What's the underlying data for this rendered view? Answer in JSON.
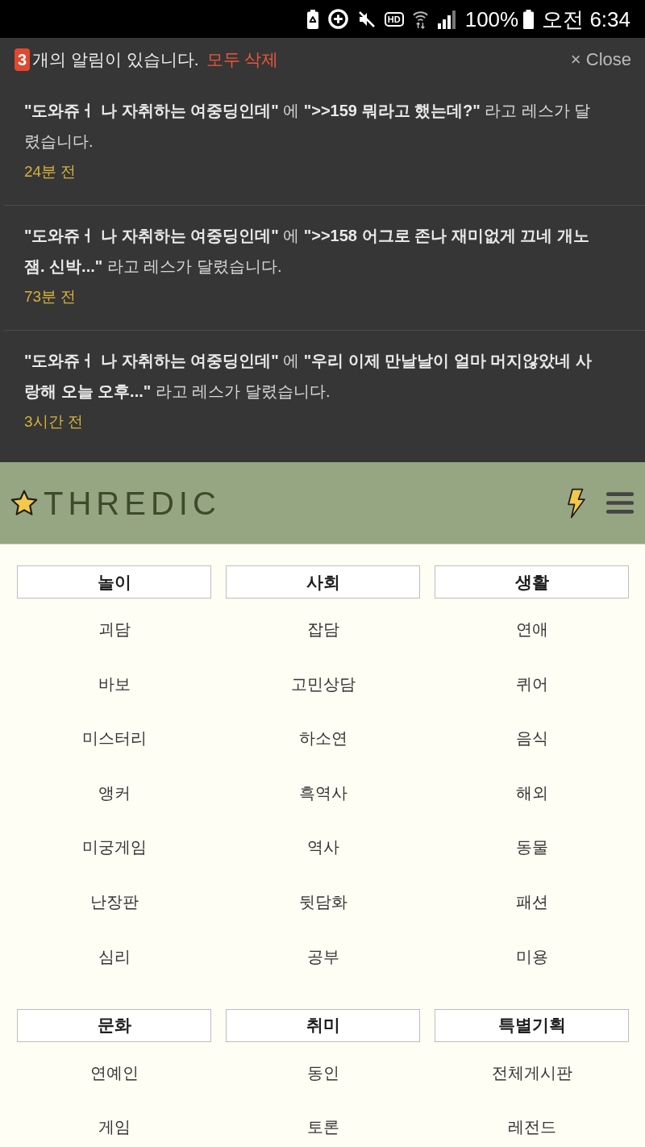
{
  "status_bar": {
    "hd_label": "HD",
    "battery_text": "100%",
    "time": "오전 6:34"
  },
  "notifications": {
    "count": "3",
    "summary": "개의 알림이 있습니다.",
    "clear_all": "모두 삭제",
    "close": "× Close",
    "items": [
      {
        "text": "**\"도와쥬ㅓ 나 자취하는 여중딩인데\"** 에 **\">>159 뭐라고 했는데?\"** 라고 레스가 달렸습니다.",
        "time": "24분 전"
      },
      {
        "text": "**\"도와쥬ㅓ 나 자취하는 여중딩인데\"** 에 **\">>158 어그로 존나 재미없게 끄네 개노잼. 신박...\"** 라고 레스가 달렸습니다.",
        "time": "73분 전"
      },
      {
        "text": "**\"도와쥬ㅓ 나 자취하는 여중딩인데\"** 에 **\"우리 이제 만날날이 얼마 머지않았네 사랑해 오늘 오후...\"** 라고 레스가 달렸습니다.",
        "time": "3시간 전"
      }
    ]
  },
  "navbar": {
    "logo_text": "THREDIC"
  },
  "menu": {
    "sections": [
      {
        "columns": [
          {
            "title": "놀이",
            "items": [
              "괴담",
              "바보",
              "미스터리",
              "앵커",
              "미궁게임",
              "난장판",
              "심리"
            ]
          },
          {
            "title": "사회",
            "items": [
              "잡담",
              "고민상담",
              "하소연",
              "흑역사",
              "역사",
              "뒷담화",
              "공부"
            ]
          },
          {
            "title": "생활",
            "items": [
              "연애",
              "퀴어",
              "음식",
              "해외",
              "동물",
              "패션",
              "미용"
            ]
          }
        ]
      },
      {
        "columns": [
          {
            "title": "문화",
            "items": [
              "연예인",
              "게임"
            ]
          },
          {
            "title": "취미",
            "items": [
              "동인",
              "토론"
            ]
          },
          {
            "title": "특별기획",
            "items": [
              "전체게시판",
              "레전드"
            ]
          }
        ]
      }
    ]
  }
}
